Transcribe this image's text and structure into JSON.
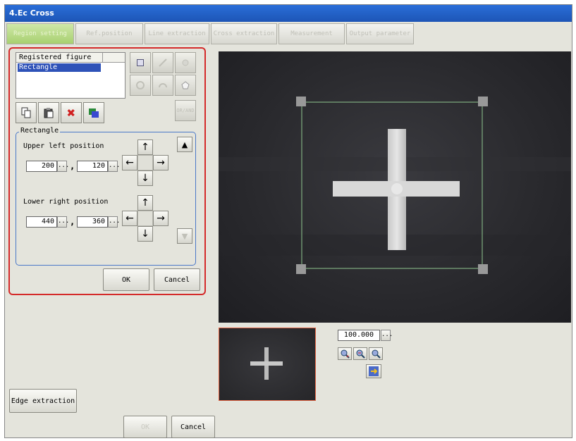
{
  "window": {
    "title": "4.Ec Cross"
  },
  "tabs": [
    {
      "label": "Region setting"
    },
    {
      "label": "Ref.position"
    },
    {
      "label": "Line extraction"
    },
    {
      "label": "Cross extraction"
    },
    {
      "label": "Measurement"
    },
    {
      "label": "Output parameter"
    }
  ],
  "figure_list": {
    "header": "Registered figure",
    "items": [
      "Rectangle"
    ]
  },
  "shape_tools": {
    "disabled_button_label": "OR/AND"
  },
  "rectangle": {
    "legend": "Rectangle",
    "upper_left": {
      "label": "Upper left position",
      "x": "200",
      "y": "120"
    },
    "lower_right": {
      "label": "Lower right position",
      "x": "440",
      "y": "360"
    }
  },
  "symbols": {
    "ellipsis": "...",
    "comma": ",",
    "up": "↑",
    "down": "↓",
    "left": "←",
    "right": "→",
    "tri_up": "▲",
    "tri_down": "▼"
  },
  "panel_buttons": {
    "ok": "OK",
    "cancel": "Cancel"
  },
  "zoom": {
    "value": "100.000"
  },
  "bottom": {
    "edge_extraction": "Edge extraction",
    "ok": "OK",
    "cancel": "Cancel"
  },
  "colors": {
    "accent_blue": "#1d55b6",
    "panel_border": "#d42a2a",
    "group_border": "#4a78c8"
  }
}
